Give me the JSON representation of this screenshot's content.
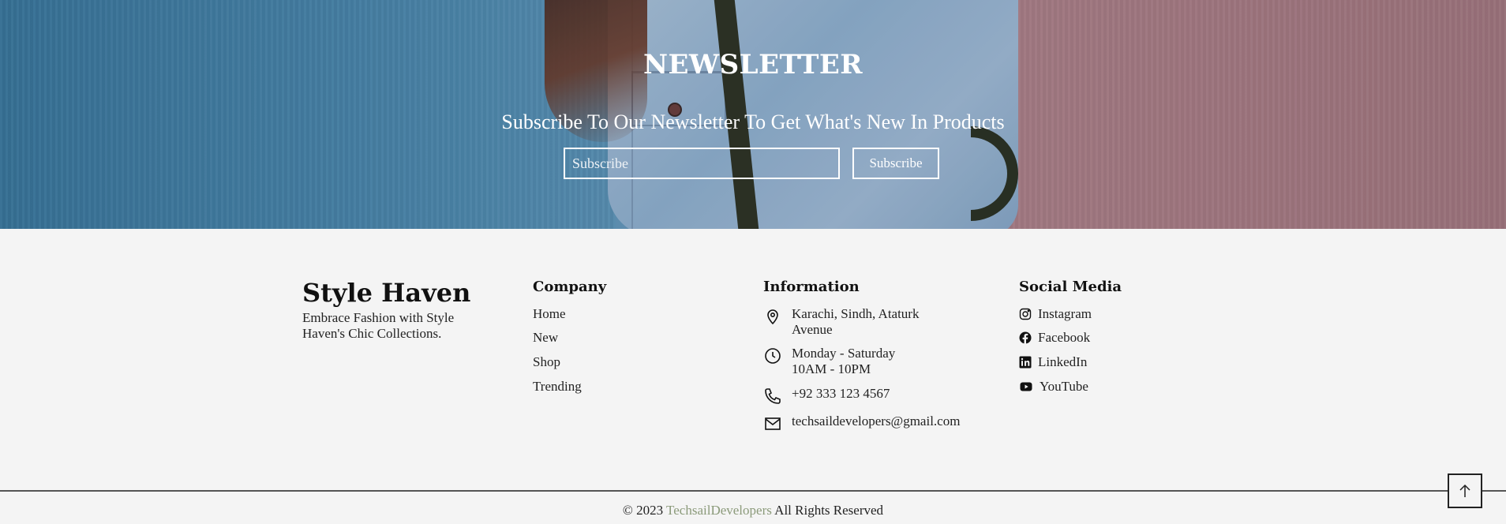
{
  "newsletter": {
    "title": "NEWSLETTER",
    "subtitle": "Subscribe To Our Newsletter To Get What's New In Products",
    "input_placeholder": "Subscribe",
    "button_label": "Subscribe"
  },
  "footer": {
    "brand": {
      "name": "Style Haven",
      "description": "Embrace Fashion with Style Haven's Chic Collections."
    },
    "company": {
      "title": "Company",
      "links": [
        "Home",
        "New",
        "Shop",
        "Trending"
      ]
    },
    "information": {
      "title": "Information",
      "items": [
        {
          "icon": "location-pin-icon",
          "text": "Karachi, Sindh, Ataturk\nAvenue"
        },
        {
          "icon": "clock-icon",
          "text": "Monday - Saturday\n10AM - 10PM"
        },
        {
          "icon": "phone-icon",
          "text": "+92 333 123 4567"
        },
        {
          "icon": "mail-icon",
          "text": "techsaildevelopers@gmail.com"
        }
      ]
    },
    "social": {
      "title": "Social Media",
      "items": [
        {
          "icon": "instagram-icon",
          "label": "Instagram"
        },
        {
          "icon": "facebook-icon",
          "label": "Facebook"
        },
        {
          "icon": "linkedin-icon",
          "label": "LinkedIn"
        },
        {
          "icon": "youtube-icon",
          "label": "YouTube"
        }
      ]
    },
    "copyright": {
      "prefix": "© 2023",
      "brand": "TechsailDevelopers",
      "suffix": "All Rights Reserved"
    },
    "to_top_icon": "arrow-up-icon"
  },
  "colors": {
    "accent": "#8b9a7a",
    "footer_bg": "#f4f4f4",
    "text": "#111111"
  }
}
